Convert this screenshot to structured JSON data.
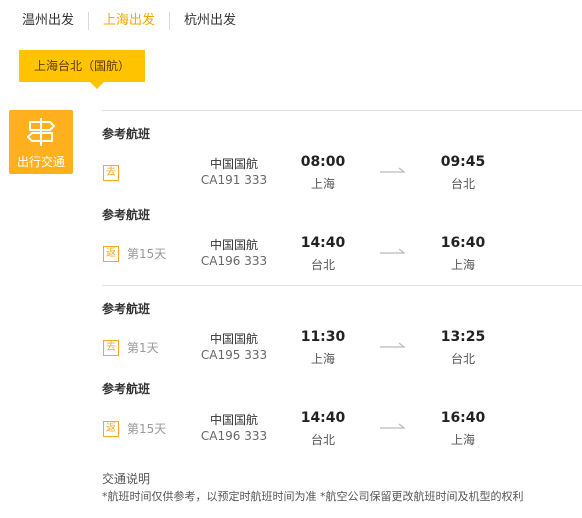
{
  "tabs": [
    {
      "label": "温州出发",
      "active": false
    },
    {
      "label": "上海出发",
      "active": true
    },
    {
      "label": "杭州出发",
      "active": false
    }
  ],
  "route_tag": "上海台北（国航）",
  "transport_label": "出行交通",
  "section_title": "参考航班",
  "flights": [
    {
      "dir": "去",
      "day": "",
      "airline": "中国国航",
      "flight_no": "CA191 333",
      "dep_time": "08:00",
      "dep_city": "上海",
      "arr_time": "09:45",
      "arr_city": "台北"
    },
    {
      "dir": "返",
      "day": "第15天",
      "airline": "中国国航",
      "flight_no": "CA196 333",
      "dep_time": "14:40",
      "dep_city": "台北",
      "arr_time": "16:40",
      "arr_city": "上海"
    },
    {
      "dir": "去",
      "day": "第1天",
      "airline": "中国国航",
      "flight_no": "CA195 333",
      "dep_time": "11:30",
      "dep_city": "上海",
      "arr_time": "13:25",
      "arr_city": "台北"
    },
    {
      "dir": "返",
      "day": "第15天",
      "airline": "中国国航",
      "flight_no": "CA196 333",
      "dep_time": "14:40",
      "dep_city": "台北",
      "arr_time": "16:40",
      "arr_city": "上海"
    }
  ],
  "note": {
    "title": "交通说明",
    "text": "*航班时间仅供参考，以预定时航班时间为准  *航空公司保留更改航班时间及机型的权利"
  },
  "colors": {
    "accent": "#f5a400",
    "tag_bg": "#ffc300",
    "transport_bg": "#ffb01e"
  },
  "icons": {
    "transport": "signpost-icon",
    "arrow": "arrow-right-icon"
  }
}
